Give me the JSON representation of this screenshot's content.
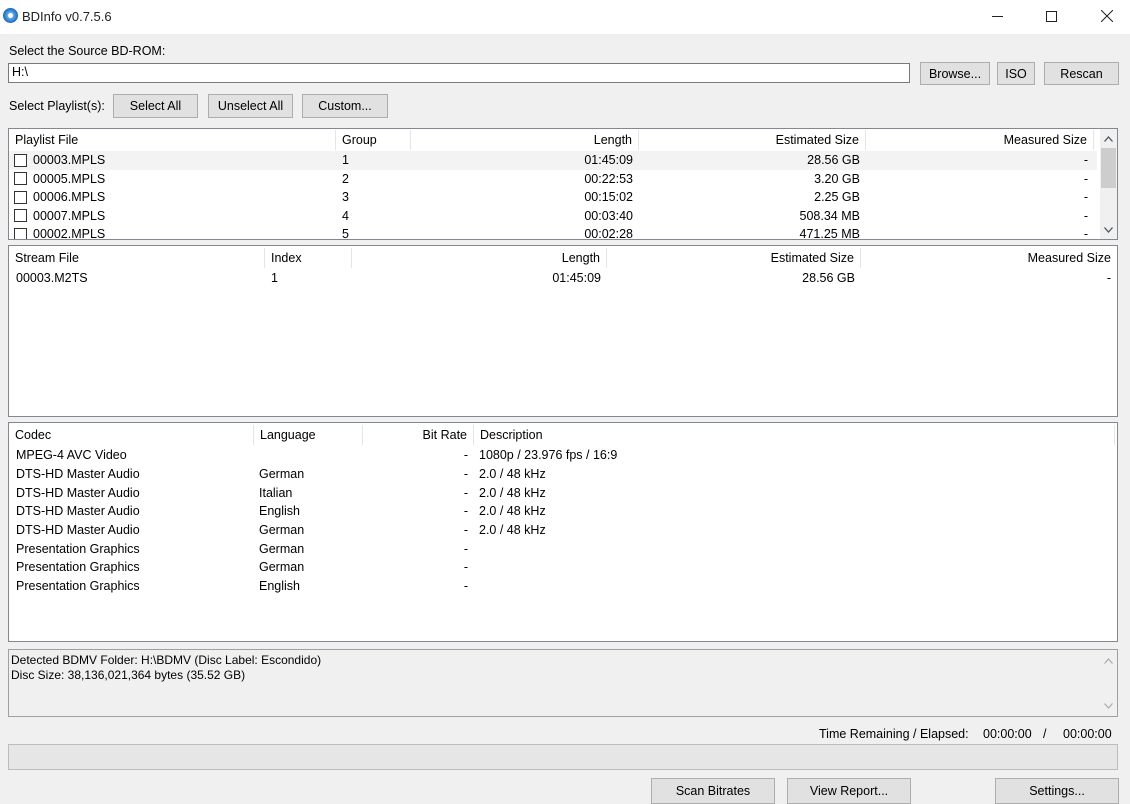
{
  "window": {
    "title": "BDInfo v0.7.5.6"
  },
  "source": {
    "label": "Select the Source BD-ROM:",
    "path": "H:\\",
    "browse": "Browse...",
    "iso": "ISO",
    "rescan": "Rescan"
  },
  "playlist_select": {
    "label": "Select Playlist(s):",
    "select_all": "Select All",
    "unselect_all": "Unselect All",
    "custom": "Custom..."
  },
  "playlists": {
    "columns": [
      "Playlist File",
      "Group",
      "Length",
      "Estimated Size",
      "Measured Size"
    ],
    "rows": [
      {
        "file": "00003.MPLS",
        "group": "1",
        "length": "01:45:09",
        "est": "28.56 GB",
        "meas": "-"
      },
      {
        "file": "00005.MPLS",
        "group": "2",
        "length": "00:22:53",
        "est": "3.20 GB",
        "meas": "-"
      },
      {
        "file": "00006.MPLS",
        "group": "3",
        "length": "00:15:02",
        "est": "2.25 GB",
        "meas": "-"
      },
      {
        "file": "00007.MPLS",
        "group": "4",
        "length": "00:03:40",
        "est": "508.34 MB",
        "meas": "-"
      },
      {
        "file": "00002.MPLS",
        "group": "5",
        "length": "00:02:28",
        "est": "471.25 MB",
        "meas": "-"
      }
    ]
  },
  "streams": {
    "columns": [
      "Stream File",
      "Index",
      "Length",
      "Estimated Size",
      "Measured Size"
    ],
    "rows": [
      {
        "file": "00003.M2TS",
        "index": "1",
        "length": "01:45:09",
        "est": "28.56 GB",
        "meas": "-"
      }
    ]
  },
  "codecs": {
    "columns": [
      "Codec",
      "Language",
      "Bit Rate",
      "Description"
    ],
    "rows": [
      {
        "codec": "MPEG-4 AVC Video",
        "lang": "",
        "bitrate": "-",
        "desc": "1080p / 23.976 fps / 16:9"
      },
      {
        "codec": "DTS-HD Master Audio",
        "lang": "German",
        "bitrate": "-",
        "desc": "2.0 / 48 kHz"
      },
      {
        "codec": "DTS-HD Master Audio",
        "lang": "Italian",
        "bitrate": "-",
        "desc": "2.0 / 48 kHz"
      },
      {
        "codec": "DTS-HD Master Audio",
        "lang": "English",
        "bitrate": "-",
        "desc": "2.0 / 48 kHz"
      },
      {
        "codec": "DTS-HD Master Audio",
        "lang": "German",
        "bitrate": "-",
        "desc": "2.0 / 48 kHz"
      },
      {
        "codec": "Presentation Graphics",
        "lang": "German",
        "bitrate": "-",
        "desc": ""
      },
      {
        "codec": "Presentation Graphics",
        "lang": "German",
        "bitrate": "-",
        "desc": ""
      },
      {
        "codec": "Presentation Graphics",
        "lang": "English",
        "bitrate": "-",
        "desc": ""
      }
    ]
  },
  "log": {
    "line1": "Detected BDMV Folder: H:\\BDMV (Disc Label: Escondido)",
    "line2": "Disc Size: 38,136,021,364 bytes (35.52 GB)"
  },
  "status": {
    "time_label": "Time Remaining / Elapsed:",
    "remaining": "00:00:00",
    "sep": "/",
    "elapsed": "00:00:00"
  },
  "progress": {
    "value": 0
  },
  "buttons": {
    "scan": "Scan Bitrates",
    "report": "View Report...",
    "settings": "Settings..."
  }
}
